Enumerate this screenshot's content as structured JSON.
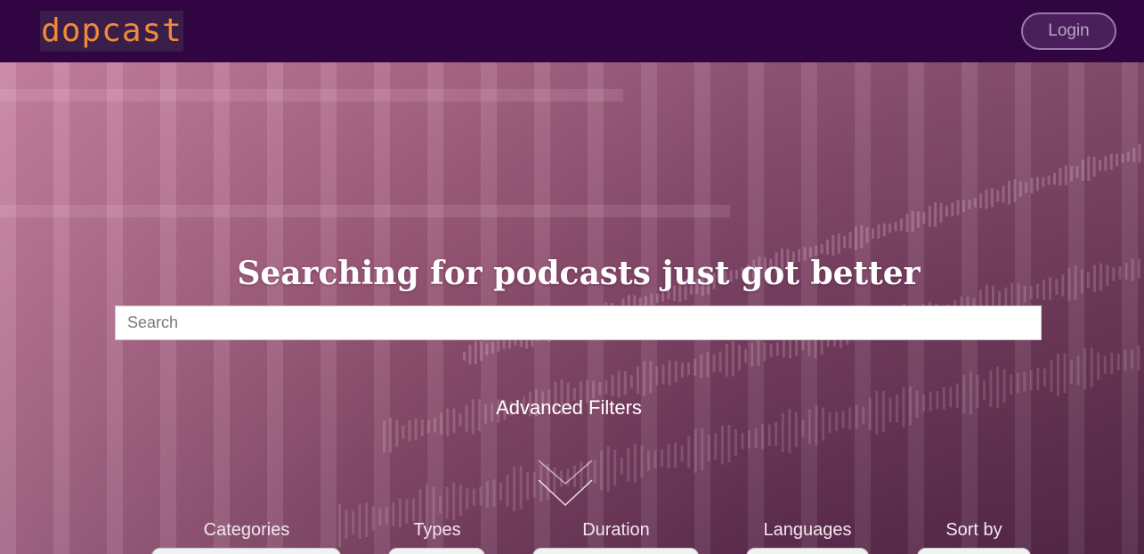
{
  "brand": {
    "logo_text": "dopcast",
    "logo_color": "#f08a3a",
    "nav_bg": "#300541"
  },
  "nav": {
    "login_label": "Login"
  },
  "hero": {
    "headline": "Searching for podcasts just got better",
    "search_placeholder": "Search",
    "advanced_filters_label": "Advanced Filters",
    "toggle_icon": "double-chevron-down-icon"
  },
  "filters": [
    {
      "label": "Categories"
    },
    {
      "label": "Types"
    },
    {
      "label": "Duration"
    },
    {
      "label": "Languages"
    },
    {
      "label": "Sort by"
    }
  ]
}
